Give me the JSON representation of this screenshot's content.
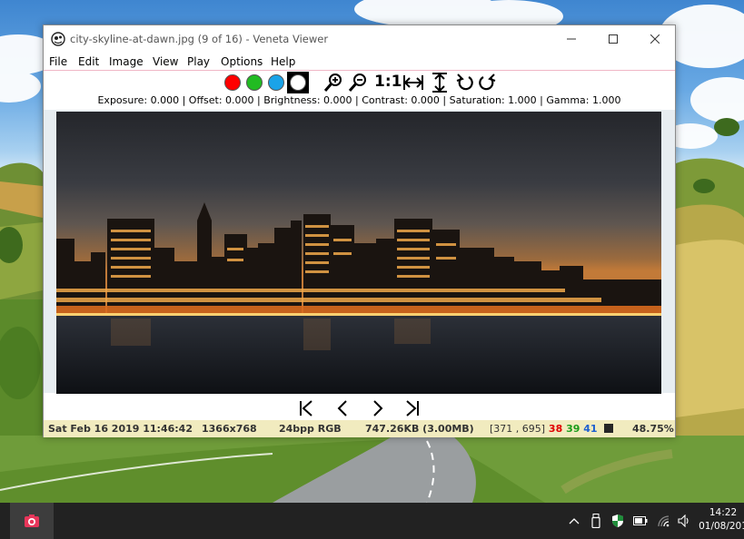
{
  "window": {
    "title": "city-skyline-at-dawn.jpg (9 of 16) - Veneta Viewer"
  },
  "menu": [
    "File",
    "Edit",
    "Image",
    "View",
    "Play",
    "Options",
    "Help"
  ],
  "toolbar": {
    "channel_colors": [
      "#ff0000",
      "#22bb22",
      "#1aa3e8",
      "#ffffff"
    ],
    "actual_size_label": "1:1"
  },
  "adjustments": {
    "text": "Exposure: 0.000  |  Offset: 0.000  |  Brightness: 0.000  |  Contrast: 0.000  |  Saturation: 1.000  |  Gamma: 1.000"
  },
  "status": {
    "date": "Sat Feb 16 2019 11:46:42",
    "dimensions": "1366x768",
    "format": "24bpp RGB",
    "filesize": "747.26KB (3.00MB)",
    "cursor": "[371 , 695]",
    "r": "38",
    "g": "39",
    "b": "41",
    "zoom": "48.75%",
    "r_color": "#e00000",
    "g_color": "#1a9c1a",
    "b_color": "#1e5fd0"
  },
  "taskbar": {
    "time": "14:22",
    "date": "01/08/201"
  }
}
